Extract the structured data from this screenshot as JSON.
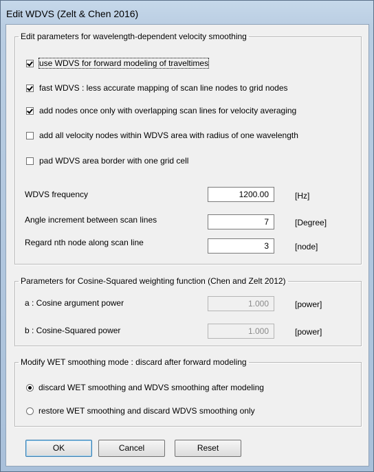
{
  "window": {
    "title": "Edit WDVS (Zelt & Chen 2016)"
  },
  "group_wdvs": {
    "legend": "Edit parameters for wavelength-dependent velocity smoothing",
    "checkboxes": [
      {
        "label": "use WDVS for forward modeling of traveltimes",
        "checked": true
      },
      {
        "label": "fast WDVS : less accurate mapping of scan line nodes to grid nodes",
        "checked": true
      },
      {
        "label": "add nodes once only with overlapping scan lines for velocity averaging",
        "checked": true
      },
      {
        "label": "add all velocity nodes within WDVS area with radius of one wavelength",
        "checked": false
      },
      {
        "label": "pad WDVS area border with one grid cell",
        "checked": false
      }
    ],
    "fields": [
      {
        "label": "WDVS frequency",
        "value": "1200.00",
        "unit": "[Hz]"
      },
      {
        "label": "Angle increment between scan lines",
        "value": "7",
        "unit": "[Degree]"
      },
      {
        "label": "Regard nth node along scan line",
        "value": "3",
        "unit": "[node]"
      }
    ]
  },
  "group_cosine": {
    "legend": "Parameters for Cosine-Squared weighting function (Chen and Zelt 2012)",
    "fields": [
      {
        "label": "a : Cosine argument power",
        "value": "1.000",
        "unit": "[power]"
      },
      {
        "label": "b : Cosine-Squared power",
        "value": "1.000",
        "unit": "[power]"
      }
    ]
  },
  "group_wet": {
    "legend": "Modify WET smoothing mode : discard after forward modeling",
    "radios": [
      {
        "label": "discard WET smoothing and WDVS smoothing after modeling",
        "checked": true
      },
      {
        "label": "restore WET smoothing and discard WDVS smoothing only",
        "checked": false
      }
    ]
  },
  "buttons": {
    "ok": "OK",
    "cancel": "Cancel",
    "reset": "Reset"
  }
}
